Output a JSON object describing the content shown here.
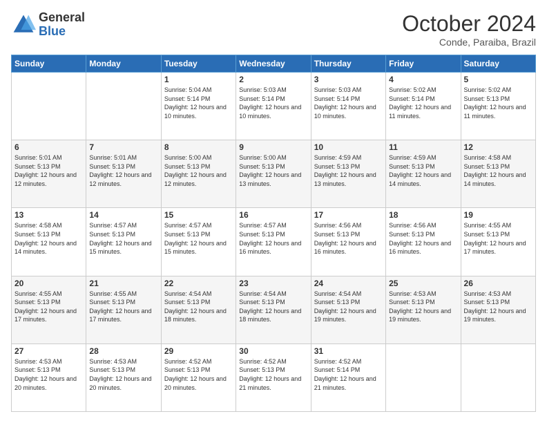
{
  "logo": {
    "general": "General",
    "blue": "Blue"
  },
  "header": {
    "month": "October 2024",
    "location": "Conde, Paraiba, Brazil"
  },
  "weekdays": [
    "Sunday",
    "Monday",
    "Tuesday",
    "Wednesday",
    "Thursday",
    "Friday",
    "Saturday"
  ],
  "weeks": [
    [
      {
        "day": null,
        "info": null
      },
      {
        "day": null,
        "info": null
      },
      {
        "day": "1",
        "info": "Sunrise: 5:04 AM\nSunset: 5:14 PM\nDaylight: 12 hours and 10 minutes."
      },
      {
        "day": "2",
        "info": "Sunrise: 5:03 AM\nSunset: 5:14 PM\nDaylight: 12 hours and 10 minutes."
      },
      {
        "day": "3",
        "info": "Sunrise: 5:03 AM\nSunset: 5:14 PM\nDaylight: 12 hours and 10 minutes."
      },
      {
        "day": "4",
        "info": "Sunrise: 5:02 AM\nSunset: 5:14 PM\nDaylight: 12 hours and 11 minutes."
      },
      {
        "day": "5",
        "info": "Sunrise: 5:02 AM\nSunset: 5:13 PM\nDaylight: 12 hours and 11 minutes."
      }
    ],
    [
      {
        "day": "6",
        "info": "Sunrise: 5:01 AM\nSunset: 5:13 PM\nDaylight: 12 hours and 12 minutes."
      },
      {
        "day": "7",
        "info": "Sunrise: 5:01 AM\nSunset: 5:13 PM\nDaylight: 12 hours and 12 minutes."
      },
      {
        "day": "8",
        "info": "Sunrise: 5:00 AM\nSunset: 5:13 PM\nDaylight: 12 hours and 12 minutes."
      },
      {
        "day": "9",
        "info": "Sunrise: 5:00 AM\nSunset: 5:13 PM\nDaylight: 12 hours and 13 minutes."
      },
      {
        "day": "10",
        "info": "Sunrise: 4:59 AM\nSunset: 5:13 PM\nDaylight: 12 hours and 13 minutes."
      },
      {
        "day": "11",
        "info": "Sunrise: 4:59 AM\nSunset: 5:13 PM\nDaylight: 12 hours and 14 minutes."
      },
      {
        "day": "12",
        "info": "Sunrise: 4:58 AM\nSunset: 5:13 PM\nDaylight: 12 hours and 14 minutes."
      }
    ],
    [
      {
        "day": "13",
        "info": "Sunrise: 4:58 AM\nSunset: 5:13 PM\nDaylight: 12 hours and 14 minutes."
      },
      {
        "day": "14",
        "info": "Sunrise: 4:57 AM\nSunset: 5:13 PM\nDaylight: 12 hours and 15 minutes."
      },
      {
        "day": "15",
        "info": "Sunrise: 4:57 AM\nSunset: 5:13 PM\nDaylight: 12 hours and 15 minutes."
      },
      {
        "day": "16",
        "info": "Sunrise: 4:57 AM\nSunset: 5:13 PM\nDaylight: 12 hours and 16 minutes."
      },
      {
        "day": "17",
        "info": "Sunrise: 4:56 AM\nSunset: 5:13 PM\nDaylight: 12 hours and 16 minutes."
      },
      {
        "day": "18",
        "info": "Sunrise: 4:56 AM\nSunset: 5:13 PM\nDaylight: 12 hours and 16 minutes."
      },
      {
        "day": "19",
        "info": "Sunrise: 4:55 AM\nSunset: 5:13 PM\nDaylight: 12 hours and 17 minutes."
      }
    ],
    [
      {
        "day": "20",
        "info": "Sunrise: 4:55 AM\nSunset: 5:13 PM\nDaylight: 12 hours and 17 minutes."
      },
      {
        "day": "21",
        "info": "Sunrise: 4:55 AM\nSunset: 5:13 PM\nDaylight: 12 hours and 17 minutes."
      },
      {
        "day": "22",
        "info": "Sunrise: 4:54 AM\nSunset: 5:13 PM\nDaylight: 12 hours and 18 minutes."
      },
      {
        "day": "23",
        "info": "Sunrise: 4:54 AM\nSunset: 5:13 PM\nDaylight: 12 hours and 18 minutes."
      },
      {
        "day": "24",
        "info": "Sunrise: 4:54 AM\nSunset: 5:13 PM\nDaylight: 12 hours and 19 minutes."
      },
      {
        "day": "25",
        "info": "Sunrise: 4:53 AM\nSunset: 5:13 PM\nDaylight: 12 hours and 19 minutes."
      },
      {
        "day": "26",
        "info": "Sunrise: 4:53 AM\nSunset: 5:13 PM\nDaylight: 12 hours and 19 minutes."
      }
    ],
    [
      {
        "day": "27",
        "info": "Sunrise: 4:53 AM\nSunset: 5:13 PM\nDaylight: 12 hours and 20 minutes."
      },
      {
        "day": "28",
        "info": "Sunrise: 4:53 AM\nSunset: 5:13 PM\nDaylight: 12 hours and 20 minutes."
      },
      {
        "day": "29",
        "info": "Sunrise: 4:52 AM\nSunset: 5:13 PM\nDaylight: 12 hours and 20 minutes."
      },
      {
        "day": "30",
        "info": "Sunrise: 4:52 AM\nSunset: 5:13 PM\nDaylight: 12 hours and 21 minutes."
      },
      {
        "day": "31",
        "info": "Sunrise: 4:52 AM\nSunset: 5:14 PM\nDaylight: 12 hours and 21 minutes."
      },
      {
        "day": null,
        "info": null
      },
      {
        "day": null,
        "info": null
      }
    ]
  ]
}
